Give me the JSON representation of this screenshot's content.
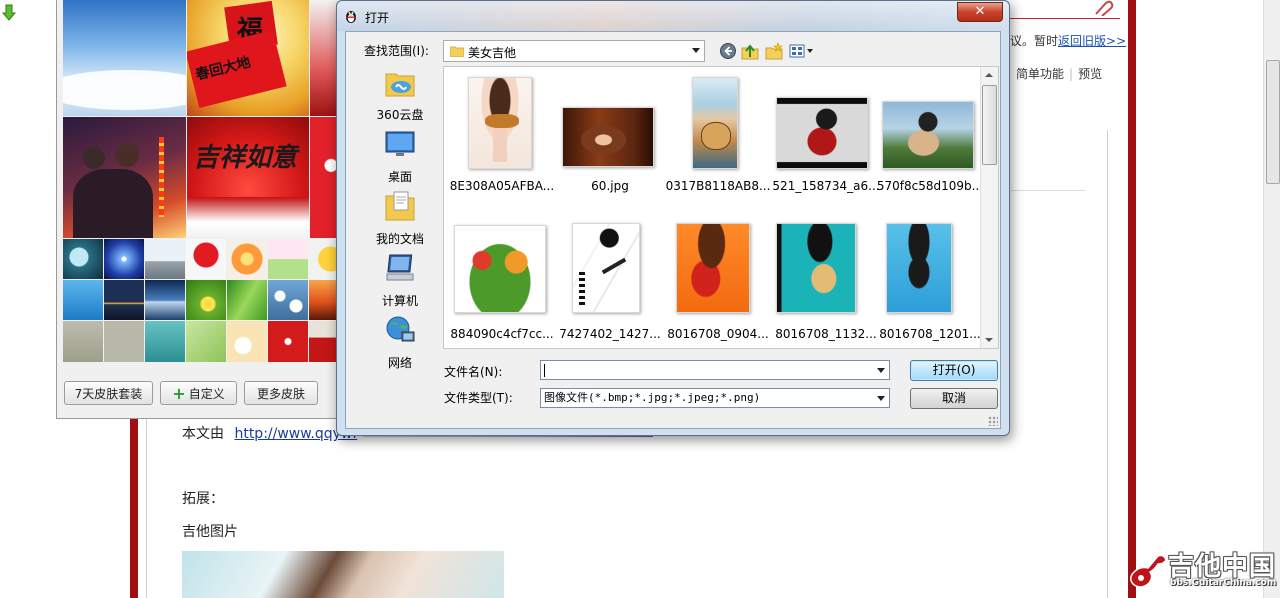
{
  "dialog": {
    "title": "打开",
    "lookin_label": "查找范围(I):",
    "current_folder": "美女吉他",
    "places": [
      {
        "label": "360云盘",
        "icon": "cloud-drive-icon"
      },
      {
        "label": "桌面",
        "icon": "desktop-icon"
      },
      {
        "label": "我的文档",
        "icon": "documents-icon"
      },
      {
        "label": "计算机",
        "icon": "computer-icon"
      },
      {
        "label": "网络",
        "icon": "network-icon"
      }
    ],
    "files": [
      {
        "name": "8E308A05AFBA..."
      },
      {
        "name": "60.jpg"
      },
      {
        "name": "0317B8118AB8..."
      },
      {
        "name": "521_158734_a6..."
      },
      {
        "name": "570f8c58d109b..."
      },
      {
        "name": "884090c4cf7cc..."
      },
      {
        "name": "7427402_1427..."
      },
      {
        "name": "8016708_0904..."
      },
      {
        "name": "8016708_1132..."
      },
      {
        "name": "8016708_1201..."
      }
    ],
    "filename_label": "文件名(N):",
    "filename_value": "",
    "filetype_label": "文件类型(T):",
    "filetype_value": "图像文件(*.bmp;*.jpg;*.jpeg;*.png)",
    "open_button": "打开(O)",
    "cancel_button": "取消",
    "close_glyph": "✕"
  },
  "skin_panel": {
    "buttons": {
      "seven_day": "7天皮肤套装",
      "custom": "自定义",
      "more": "更多皮肤"
    },
    "tile_text": {
      "fu": "福",
      "couplet": "春回大地",
      "jixiang": "吉祥如意"
    }
  },
  "editor": {
    "top_right_text": "议。暂时",
    "return_old": "返回旧版>>",
    "tools": [
      "简单功能",
      "预览"
    ],
    "source_prefix": "本文由",
    "source_link": "http://www.qqywf",
    "extend_label": "拓展：",
    "guitar_pics": "吉他图片"
  },
  "watermark": {
    "cn": "吉他中国",
    "en": "bbs.GuitarChina.com"
  }
}
